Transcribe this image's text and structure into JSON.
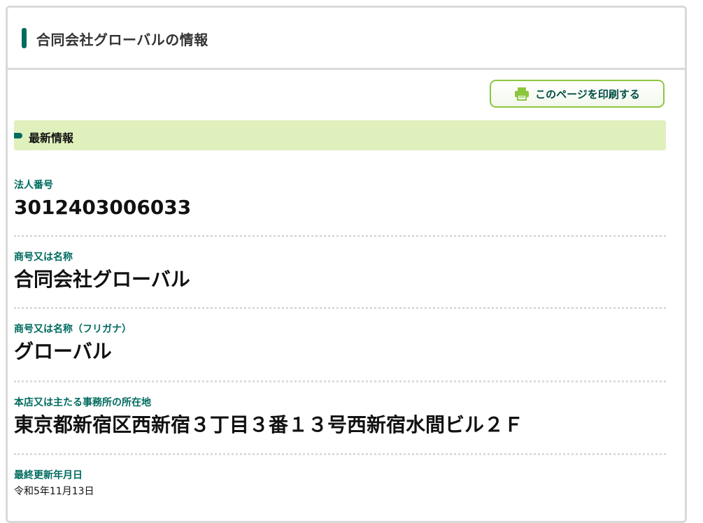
{
  "header": {
    "title": "合同会社グローバルの情報"
  },
  "toolbar": {
    "print_label": "このページを印刷する",
    "print_icon": "printer-icon"
  },
  "section": {
    "title": "最新情報"
  },
  "fields": [
    {
      "label": "法人番号",
      "value": "3012403006033"
    },
    {
      "label": "商号又は名称",
      "value": "合同会社グローバル"
    },
    {
      "label": "商号又は名称（フリガナ）",
      "value": "グローバル"
    },
    {
      "label": "本店又は主たる事務所の所在地",
      "value": "東京都新宿区西新宿３丁目３番１３号西新宿水間ビル２Ｆ"
    },
    {
      "label": "最終更新年月日",
      "value": "令和5年11月13日"
    }
  ],
  "colors": {
    "accent": "#006b5f",
    "section_bg": "#dff0bd",
    "button_border": "#8cc63f"
  }
}
